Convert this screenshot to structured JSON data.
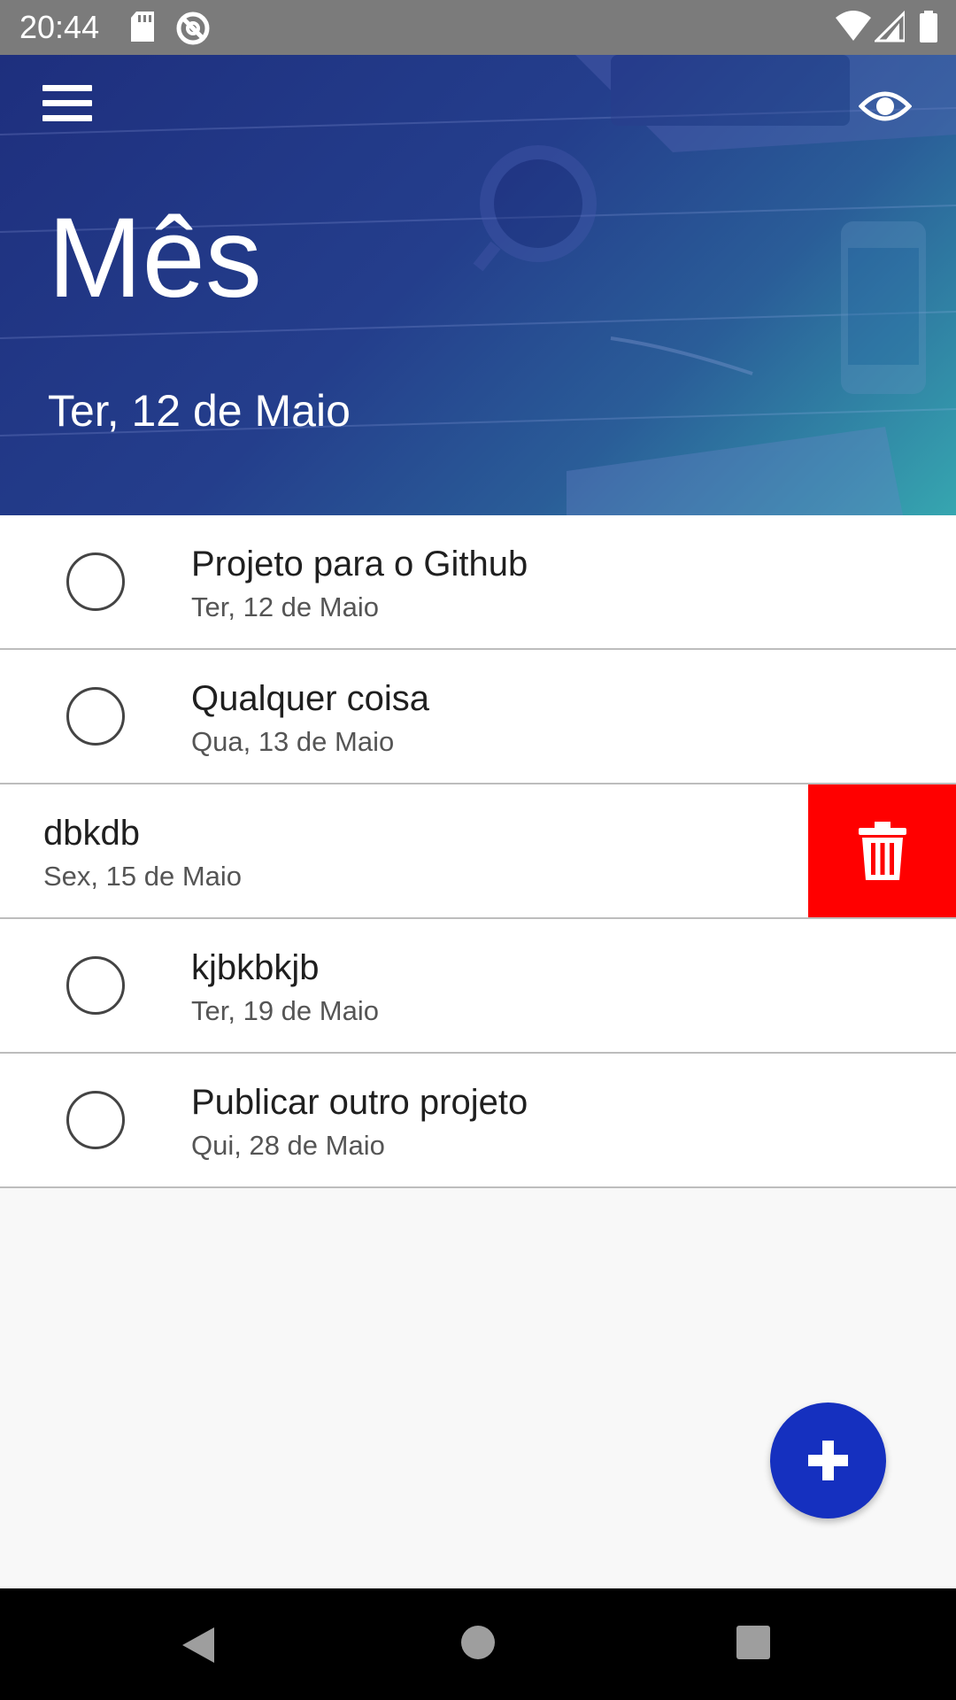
{
  "status_bar": {
    "time": "20:44",
    "icons": [
      "sd-card-icon",
      "sync-icon",
      "wifi-icon",
      "signal-icon",
      "battery-icon"
    ]
  },
  "header": {
    "title": "Mês",
    "date": "Ter, 12 de Maio",
    "menu_icon": "hamburger-menu-icon",
    "visibility_icon": "eye-icon"
  },
  "tasks": [
    {
      "title": "Projeto para o Github",
      "date": "Ter, 12 de Maio",
      "done": false
    },
    {
      "title": "Qualquer coisa",
      "date": "Qua, 13 de Maio",
      "done": false
    },
    {
      "title": "dbkdb",
      "date": "Sex, 15 de Maio",
      "done": false,
      "swiped": true
    },
    {
      "title": "kjbkbkjb",
      "date": "Ter, 19 de Maio",
      "done": false
    },
    {
      "title": "Publicar outro projeto",
      "date": "Qui, 28 de Maio",
      "done": false
    }
  ],
  "fab": {
    "icon": "plus-icon",
    "color": "#1530bf"
  },
  "colors": {
    "delete": "#ff0000",
    "header_start": "#1e2f7e",
    "header_end": "#36a6b0"
  }
}
